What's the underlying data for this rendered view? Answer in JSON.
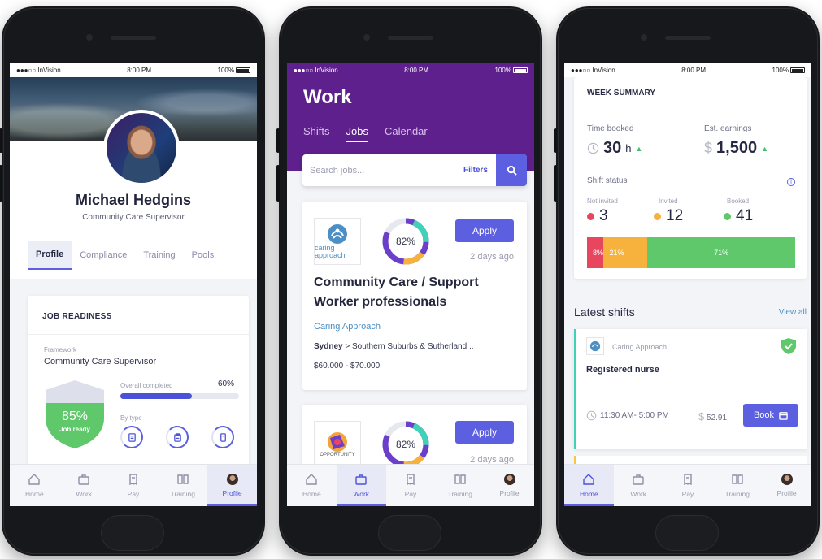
{
  "status": {
    "carrier": "●●●○○ InVision",
    "time": "8:00 PM",
    "battery": "100%"
  },
  "nav": {
    "home": "Home",
    "work": "Work",
    "pay": "Pay",
    "training": "Training",
    "profile": "Profile"
  },
  "profile": {
    "name": "Michael Hedgins",
    "role": "Community Care Supervisor",
    "tabs": [
      "Profile",
      "Compliance",
      "Training",
      "Pools"
    ],
    "readiness": {
      "title": "JOB READINESS",
      "framework_label": "Framework",
      "framework_value": "Community Care Supervisor",
      "percent": "85%",
      "ready_label": "Job ready",
      "overall_label": "Overall completed",
      "overall_pct": "60%",
      "overall_value": 0.6,
      "by_type_label": "By type"
    }
  },
  "work": {
    "title": "Work",
    "tabs": [
      "Shifts",
      "Jobs",
      "Calendar"
    ],
    "active_tab": "Jobs",
    "search": {
      "placeholder": "Search jobs...",
      "filters": "Filters"
    },
    "jobs": [
      {
        "logo_text": "caring approach",
        "match": "82%",
        "match_value": 0.82,
        "apply": "Apply",
        "ago": "2 days ago",
        "title": "Community Care / Support Worker professionals",
        "org": "Caring Approach",
        "location_city": "Sydney",
        "location_rest": "> Southern Suburbs & Sutherland...",
        "salary": "$60.000 - $70.000"
      },
      {
        "logo_text": "OPPORTUNITY",
        "match": "82%",
        "match_value": 0.82,
        "apply": "Apply",
        "ago": "2 days ago"
      }
    ]
  },
  "summary": {
    "title": "WEEK SUMMARY",
    "time_booked_label": "Time booked",
    "time_booked_value": "30",
    "time_booked_unit": "h",
    "earnings_label": "Est. earnings",
    "earnings_currency": "$",
    "earnings_value": "1,500",
    "shift_status_label": "Shift status",
    "not_invited_label": "Not invited",
    "invited_label": "Invited",
    "booked_label": "Booked",
    "not_invited": "3",
    "invited": "12",
    "booked": "41",
    "segments": [
      {
        "label": "8%",
        "value": 8,
        "color": "#e8465f"
      },
      {
        "label": "21%",
        "value": 21,
        "color": "#f7b23e"
      },
      {
        "label": "71%",
        "value": 71,
        "color": "#5fc86a"
      }
    ],
    "latest_title": "Latest shifts",
    "view_all": "View all",
    "shift": {
      "org": "Caring Approach",
      "role": "Registered nurse",
      "time": "11:30 AM- 5:00 PM",
      "currency": "$",
      "pay": "52.91",
      "book": "Book"
    }
  }
}
